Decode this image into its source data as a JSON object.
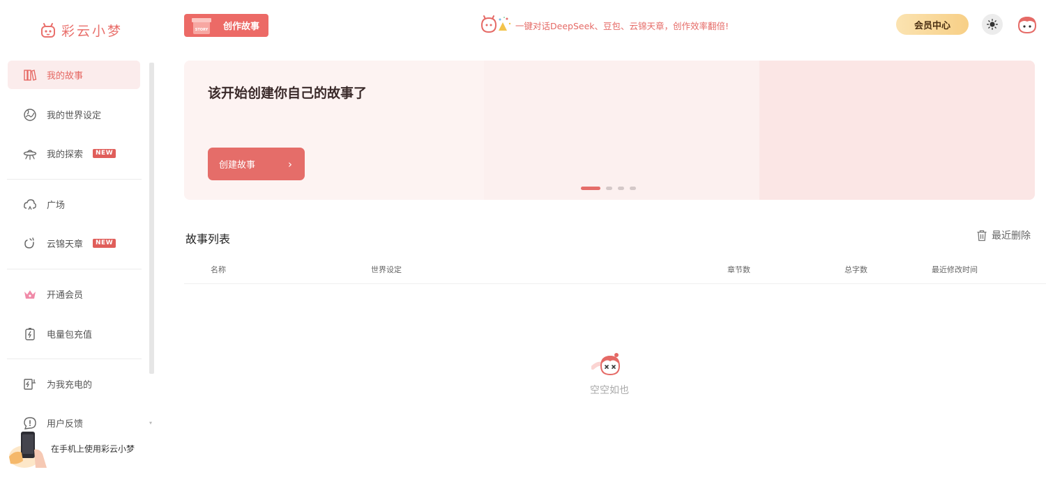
{
  "app": {
    "name": "彩云小梦"
  },
  "sidebar": {
    "items": [
      {
        "label": "我的故事"
      },
      {
        "label": "我的世界设定"
      },
      {
        "label": "我的探索",
        "badge": "NEW"
      },
      {
        "label": "广场"
      },
      {
        "label": "云锦天章",
        "badge": "NEW"
      },
      {
        "label": "开通会员"
      },
      {
        "label": "电量包充值"
      },
      {
        "label": "为我充电的"
      },
      {
        "label": "用户反馈"
      }
    ],
    "mobile_promo": "在手机上使用彩云小梦"
  },
  "topbar": {
    "create_label": "创作故事",
    "create_art_text": "STORY",
    "announcement": "一键对话DeepSeek、豆包、云锦天章，创作效率翻倍!",
    "vip_label": "会员中心"
  },
  "banner": {
    "headline": "该开始创建你自己的故事了",
    "cta": "创建故事",
    "slides": 4,
    "active_slide": 1
  },
  "stories": {
    "title": "故事列表",
    "trash_label": "最近删除",
    "columns": [
      "名称",
      "世界设定",
      "章节数",
      "总字数",
      "最近修改时间"
    ],
    "rows": [],
    "empty_text": "空空如也"
  },
  "colors": {
    "accent": "#e56d69",
    "active_bg": "#fbecec",
    "banner_bg": "#fdf3f2",
    "vip_gold": "#f7cf86"
  }
}
